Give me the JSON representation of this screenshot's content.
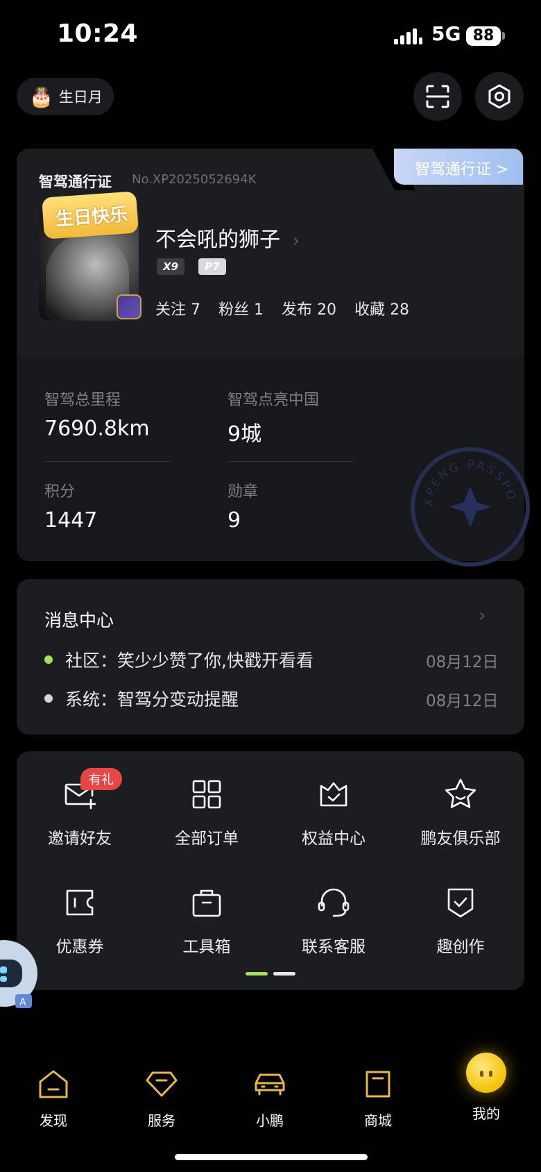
{
  "status_bar": {
    "time": "10:24",
    "network": "5G",
    "battery": "88"
  },
  "top": {
    "birthday_chip": "生日月",
    "birthday_icon": "cake-icon",
    "scan_icon": "scan-icon",
    "settings_icon": "settings-hexagon-icon"
  },
  "passport": {
    "title": "智驾通行证",
    "number": "No.XP2025052694K",
    "tab_label": "智驾通行证 >",
    "birthday_badge": "生日快乐",
    "username": "不会吼的狮子",
    "car_tags": [
      "X9",
      "P7"
    ],
    "stats": [
      {
        "label": "关注",
        "value": "7"
      },
      {
        "label": "粉丝",
        "value": "1"
      },
      {
        "label": "发布",
        "value": "20"
      },
      {
        "label": "收藏",
        "value": "28"
      }
    ],
    "metrics": [
      {
        "label": "智驾总里程",
        "value": "7690.8km"
      },
      {
        "label": "智驾点亮中国",
        "value": "9城"
      },
      {
        "label": "积分",
        "value": "1447"
      },
      {
        "label": "勋章",
        "value": "9"
      }
    ],
    "stamp_text": "XPENG PASSPORT"
  },
  "messages": {
    "title": "消息中心",
    "items": [
      {
        "text": "社区：笑少少赞了你,快戳开看看",
        "date": "08月12日",
        "dot_color": "#a8e05f"
      },
      {
        "text": "系统：智驾分变动提醒",
        "date": "08月12日",
        "dot_color": "#d8d8d8"
      }
    ]
  },
  "shortcuts": {
    "gift_badge": "有礼",
    "items": [
      {
        "label": "邀请好友",
        "icon": "mail-plus-icon"
      },
      {
        "label": "全部订单",
        "icon": "grid-icon"
      },
      {
        "label": "权益中心",
        "icon": "crown-icon"
      },
      {
        "label": "鹏友俱乐部",
        "icon": "star-icon"
      },
      {
        "label": "优惠券",
        "icon": "coupon-icon"
      },
      {
        "label": "工具箱",
        "icon": "toolbox-icon"
      },
      {
        "label": "联系客服",
        "icon": "headset-icon"
      },
      {
        "label": "趣创作",
        "icon": "shield-check-icon"
      }
    ]
  },
  "nav": {
    "items": [
      {
        "label": "发现",
        "icon": "home-icon"
      },
      {
        "label": "服务",
        "icon": "diamond-icon"
      },
      {
        "label": "小鹏",
        "icon": "car-icon"
      },
      {
        "label": "商城",
        "icon": "bag-icon"
      },
      {
        "label": "我的",
        "icon": "mascot-icon"
      }
    ]
  },
  "colors": {
    "accent_green": "#a8e05f",
    "nav_gold": "#e8b84a",
    "card_bg": "#1b1d21"
  }
}
